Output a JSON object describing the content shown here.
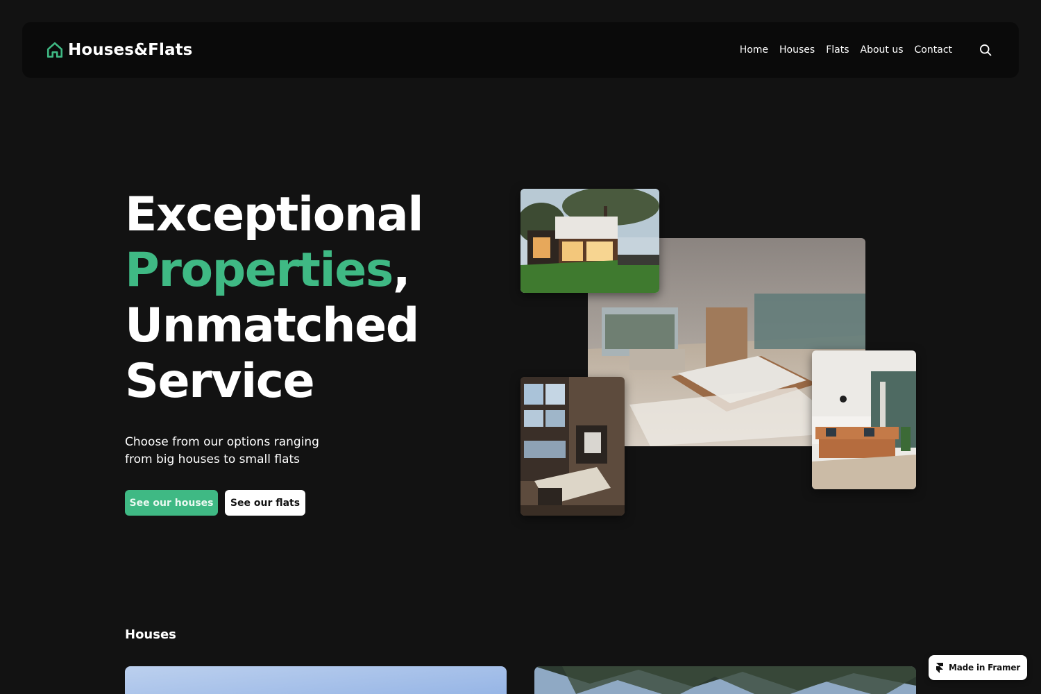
{
  "nav": {
    "brand": "Houses&Flats",
    "brand_icon": "house-icon",
    "links": [
      "Home",
      "Houses",
      "Flats",
      "About us",
      "Contact"
    ],
    "search_icon": "search-icon"
  },
  "hero": {
    "title_line1": "Exceptional",
    "title_line2_accent": "Properties",
    "title_line2_tail": ",",
    "title_line3": "Unmatched",
    "title_line4": "Service",
    "subtitle": "Choose from our options ranging from big houses to small flats",
    "primary_button": "See our houses",
    "secondary_button": "See our flats"
  },
  "section": {
    "title": "Houses"
  },
  "badge": {
    "label": "Made in Framer",
    "icon": "framer-icon"
  },
  "colors": {
    "background": "#121212",
    "navbar": "#0a0a0a",
    "accent": "#3fb984",
    "text": "#ffffff"
  }
}
